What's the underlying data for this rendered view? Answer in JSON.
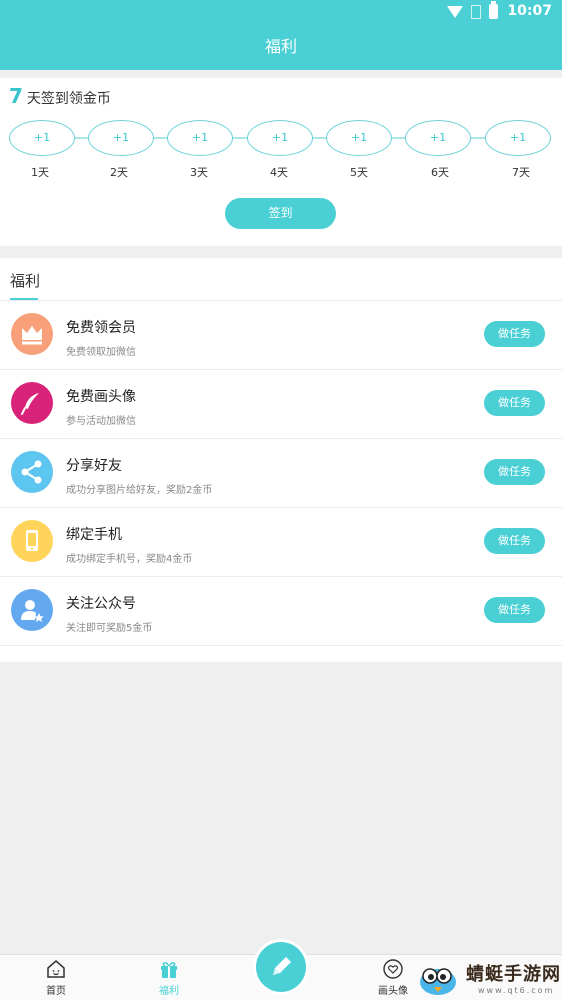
{
  "status": {
    "time": "10:07"
  },
  "header": {
    "title": "福利"
  },
  "checkin": {
    "days_count": "7",
    "title_text": "天签到领金币",
    "days": [
      {
        "reward": "+1",
        "label": "1天"
      },
      {
        "reward": "+1",
        "label": "2天"
      },
      {
        "reward": "+1",
        "label": "3天"
      },
      {
        "reward": "+1",
        "label": "4天"
      },
      {
        "reward": "+1",
        "label": "5天"
      },
      {
        "reward": "+1",
        "label": "6天"
      },
      {
        "reward": "+1",
        "label": "7天"
      }
    ],
    "button_label": "签到"
  },
  "welfare": {
    "section_title": "福利",
    "tasks": [
      {
        "name": "免费领会员",
        "desc": "免费领取加微信",
        "button": "做任务",
        "icon": "crown-icon",
        "color": "#f7a07a"
      },
      {
        "name": "免费画头像",
        "desc": "参与活动加微信",
        "button": "做任务",
        "icon": "feather-pen-icon",
        "color": "#d9237b"
      },
      {
        "name": "分享好友",
        "desc": "成功分享图片给好友，奖励2金币",
        "button": "做任务",
        "icon": "share-icon",
        "color": "#5cc6f0"
      },
      {
        "name": "绑定手机",
        "desc": "成功绑定手机号，奖励4金币",
        "button": "做任务",
        "icon": "phone-icon",
        "color": "#ffd45a"
      },
      {
        "name": "关注公众号",
        "desc": "关注即可奖励5金币",
        "button": "做任务",
        "icon": "user-star-icon",
        "color": "#64a8f0"
      }
    ]
  },
  "tabbar": {
    "home": "首页",
    "welfare": "福利",
    "avatar": "画头像",
    "active_color": "#4ad0d4"
  },
  "watermark": {
    "name": "蜻蜓手游网",
    "url": "www.qt6.com"
  }
}
